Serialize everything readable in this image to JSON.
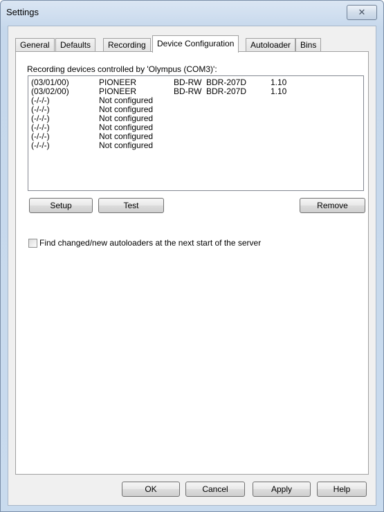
{
  "window": {
    "title": "Settings",
    "close_glyph": "✕"
  },
  "tabs": [
    {
      "label": "General",
      "active": false
    },
    {
      "label": "Defaults",
      "active": false
    },
    {
      "label": "Recording",
      "active": false
    },
    {
      "label": "Device Configuration",
      "active": true
    },
    {
      "label": "Autoloader",
      "active": false
    },
    {
      "label": "Bins",
      "active": false
    }
  ],
  "device_config": {
    "list_label": "Recording devices controlled by 'Olympus (COM3)':",
    "devices": [
      {
        "id": "(03/01/00)",
        "vendor": "PIONEER",
        "type": "BD-RW",
        "model": "BDR-207D",
        "version": "1.10"
      },
      {
        "id": "(03/02/00)",
        "vendor": "PIONEER",
        "type": "BD-RW",
        "model": "BDR-207D",
        "version": "1.10"
      },
      {
        "id": "(-/-/-)",
        "vendor": "Not configured",
        "type": "",
        "model": "",
        "version": ""
      },
      {
        "id": "(-/-/-)",
        "vendor": "Not configured",
        "type": "",
        "model": "",
        "version": ""
      },
      {
        "id": "(-/-/-)",
        "vendor": "Not configured",
        "type": "",
        "model": "",
        "version": ""
      },
      {
        "id": "(-/-/-)",
        "vendor": "Not configured",
        "type": "",
        "model": "",
        "version": ""
      },
      {
        "id": "(-/-/-)",
        "vendor": "Not configured",
        "type": "",
        "model": "",
        "version": ""
      },
      {
        "id": "(-/-/-)",
        "vendor": "Not configured",
        "type": "",
        "model": "",
        "version": ""
      }
    ],
    "setup_label": "Setup",
    "test_label": "Test",
    "remove_label": "Remove",
    "find_autoloaders_label": "Find changed/new autoloaders at the next start of the server",
    "find_autoloaders_checked": false
  },
  "footer": {
    "ok_label": "OK",
    "cancel_label": "Cancel",
    "apply_label": "Apply",
    "help_label": "Help"
  }
}
